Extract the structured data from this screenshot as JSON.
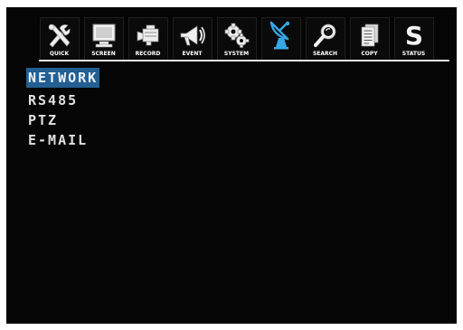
{
  "toolbar": {
    "tabs": [
      {
        "label": "QUICK",
        "icon": "tools-icon"
      },
      {
        "label": "SCREEN",
        "icon": "monitor-icon"
      },
      {
        "label": "RECORD",
        "icon": "camcorder-icon"
      },
      {
        "label": "EVENT",
        "icon": "megaphone-icon"
      },
      {
        "label": "SYSTEM",
        "icon": "gears-icon"
      },
      {
        "label": "",
        "icon": "satellite-dish-icon",
        "active": true
      },
      {
        "label": "SEARCH",
        "icon": "magnifier-icon"
      },
      {
        "label": "COPY",
        "icon": "document-copy-icon"
      },
      {
        "label": "STATUS",
        "icon": "status-s-icon"
      }
    ]
  },
  "menu": {
    "items": [
      {
        "label": "NETWORK",
        "selected": true
      },
      {
        "label": "RS485",
        "selected": false
      },
      {
        "label": "PTZ",
        "selected": false
      },
      {
        "label": "E-MAIL",
        "selected": false
      }
    ]
  },
  "colors": {
    "screen_background": "#050505",
    "selection_highlight": "#235f93",
    "text": "#e0e0e0",
    "active_icon": "#37a7e6"
  }
}
